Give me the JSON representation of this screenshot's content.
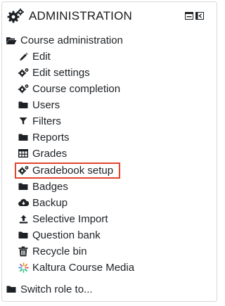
{
  "block": {
    "title": "ADMINISTRATION",
    "header_icon": "cogs-icon",
    "controls": [
      {
        "name": "dock-block-icon",
        "label": ""
      },
      {
        "name": "collapse-block-icon",
        "label": ""
      }
    ]
  },
  "menu": {
    "course_admin_label": "Course administration",
    "items": [
      {
        "label": "Edit",
        "icon": "pencil-icon"
      },
      {
        "label": "Edit settings",
        "icon": "cogs-icon"
      },
      {
        "label": "Course completion",
        "icon": "cogs-icon"
      },
      {
        "label": "Users",
        "icon": "folder-icon"
      },
      {
        "label": "Filters",
        "icon": "filter-icon"
      },
      {
        "label": "Reports",
        "icon": "folder-icon"
      },
      {
        "label": "Grades",
        "icon": "table-icon"
      },
      {
        "label": "Gradebook setup",
        "icon": "cogs-icon"
      },
      {
        "label": "Badges",
        "icon": "folder-icon"
      },
      {
        "label": "Backup",
        "icon": "cloud-download-icon"
      },
      {
        "label": "Selective Import",
        "icon": "upload-icon"
      },
      {
        "label": "Question bank",
        "icon": "folder-icon"
      },
      {
        "label": "Recycle bin",
        "icon": "trash-icon"
      },
      {
        "label": "Kaltura Course Media",
        "icon": "kaltura-icon"
      }
    ],
    "switch_role_label": "Switch role to..."
  },
  "colors": {
    "text": "#1d2125",
    "icon": "#1d2125",
    "highlight": "#e0452d"
  }
}
